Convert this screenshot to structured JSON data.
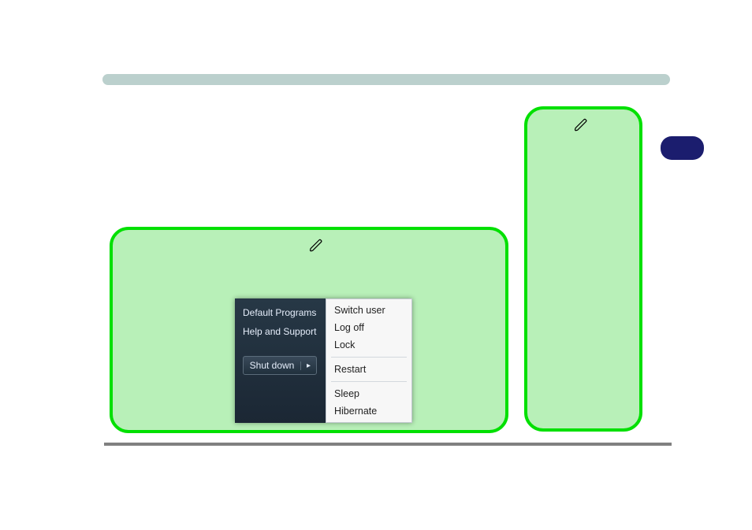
{
  "startmenu": {
    "left": {
      "item0": "Default Programs",
      "item1": "Help and Support",
      "shutdown": {
        "label": "Shut down",
        "arrow": "▸"
      }
    },
    "submenu": {
      "switch_user": "Switch user",
      "log_off": "Log off",
      "lock": "Lock",
      "restart": "Restart",
      "sleep": "Sleep",
      "hibernate": "Hibernate"
    }
  }
}
